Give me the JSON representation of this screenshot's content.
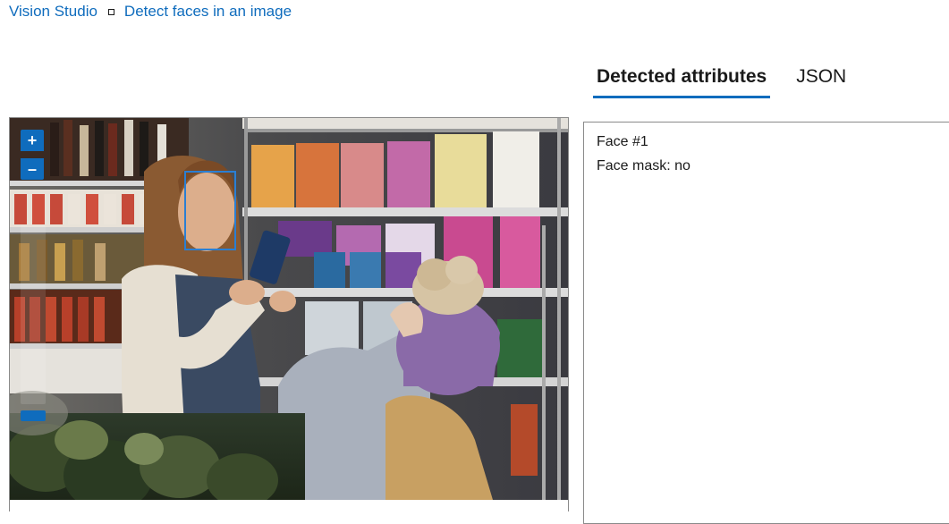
{
  "breadcrumb": {
    "items": [
      "Vision Studio",
      "Detect faces in an image"
    ]
  },
  "viewer": {
    "zoom_in_label": "+",
    "zoom_out_label": "–"
  },
  "tabs": [
    {
      "label": "Detected attributes",
      "active": true
    },
    {
      "label": "JSON",
      "active": false
    }
  ],
  "results": {
    "face_title": "Face #1",
    "face_mask": "Face mask: no"
  },
  "colors": {
    "accent": "#0f6cbd",
    "face_box": "#2a7fd4"
  }
}
